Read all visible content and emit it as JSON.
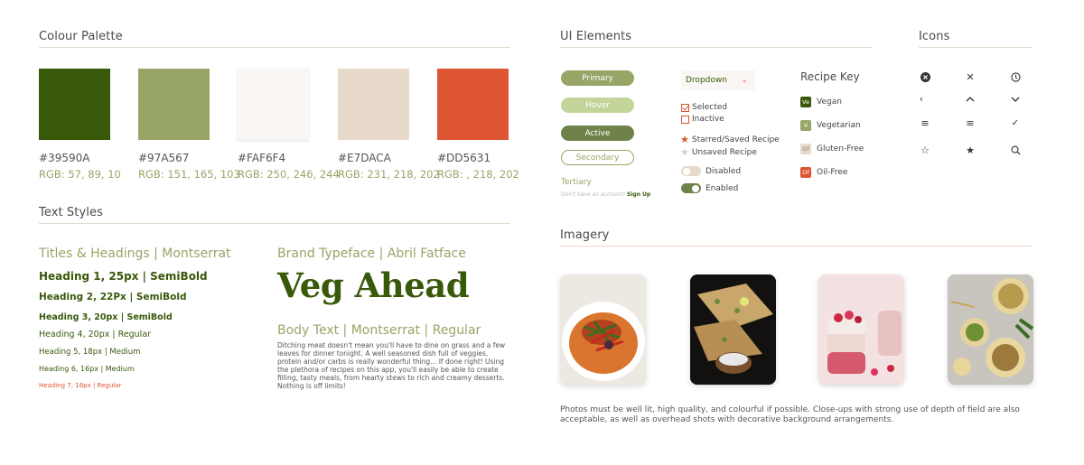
{
  "palette": {
    "title": "Colour Palette",
    "swatches": [
      {
        "hex": "#39590A",
        "rgb": "RGB: 57, 89, 10"
      },
      {
        "hex": "#97A567",
        "rgb": "RGB: 151, 165, 103"
      },
      {
        "hex": "#FAF6F4",
        "rgb": "RGB: 250, 246, 244"
      },
      {
        "hex": "#E7DACA",
        "rgb": "RGB: 231, 218, 202"
      },
      {
        "hex": "#DD5631",
        "rgb": "RGB: , 218, 202"
      }
    ]
  },
  "text_styles": {
    "title": "Text Styles",
    "heading_family": "Titles & Headings | Montserrat",
    "h1": "Heading 1, 25px | SemiBold",
    "h2": "Heading 2, 22Px | SemiBold",
    "h3": "Heading 3, 20px | SemiBold",
    "h4": "Heading 4, 20px | Regular",
    "h5": "Heading 5, 18px | Medium",
    "h6": "Heading 6, 16px | Medium",
    "h7": "Heading 7, 16px | Regular",
    "brand_family": "Brand Typeface | Abril Fatface",
    "brand_sample": "Veg Ahead",
    "body_family": "Body Text | Montserrat | Regular",
    "body_sample": "Ditching meat doesn't mean you'll have to dine on grass and a few leaves for dinner tonight. A well seasoned dish full of veggies, protein and/or carbs is really wonderful thing... If done right! Using the plethora of recipes on this app, you'll easily be able to create filling, tasty meals, from hearty stews to rich and creamy desserts. Nothing is off limits!"
  },
  "ui_elements": {
    "title": "UI Elements",
    "buttons": {
      "primary": "Primary",
      "hover": "Hover",
      "active": "Active",
      "secondary": "Secondary",
      "tertiary": "Tertiary",
      "signup_prompt": "Don't have an account?",
      "signup_link": "Sign Up"
    },
    "dropdown_label": "Dropdown",
    "checkbox_selected": "Selected",
    "checkbox_inactive": "Inactive",
    "star_saved": "Starred/Saved Recipe",
    "star_unsaved": "Unsaved Recipe",
    "toggle_disabled": "Disabled",
    "toggle_enabled": "Enabled",
    "recipe_key": {
      "title": "Recipe Key",
      "items": [
        {
          "code": "Ve",
          "label": "Vegan",
          "bg": "#39590A",
          "fg": "#ffffff"
        },
        {
          "code": "V",
          "label": "Vegetarian",
          "bg": "#97A567",
          "fg": "#ffffff"
        },
        {
          "code": "Gf",
          "label": "Gluten-Free",
          "bg": "#E7DACA",
          "fg": "#8a7b6a"
        },
        {
          "code": "Of",
          "label": "Oil-Free",
          "bg": "#DD5631",
          "fg": "#ffffff"
        }
      ]
    }
  },
  "icons": {
    "title": "Icons",
    "glyphs": [
      "⊗",
      "✕",
      "◷",
      "‹",
      "︿",
      "﹀",
      "≡",
      "≡",
      "✓",
      "☆",
      "★",
      "⌕"
    ]
  },
  "imagery": {
    "title": "Imagery",
    "caption": "Photos must be well lit, high quality, and colourful if possible. Close-ups with strong use of depth of field are also acceptable, as well as overhead shots with decorative background arrangements."
  }
}
